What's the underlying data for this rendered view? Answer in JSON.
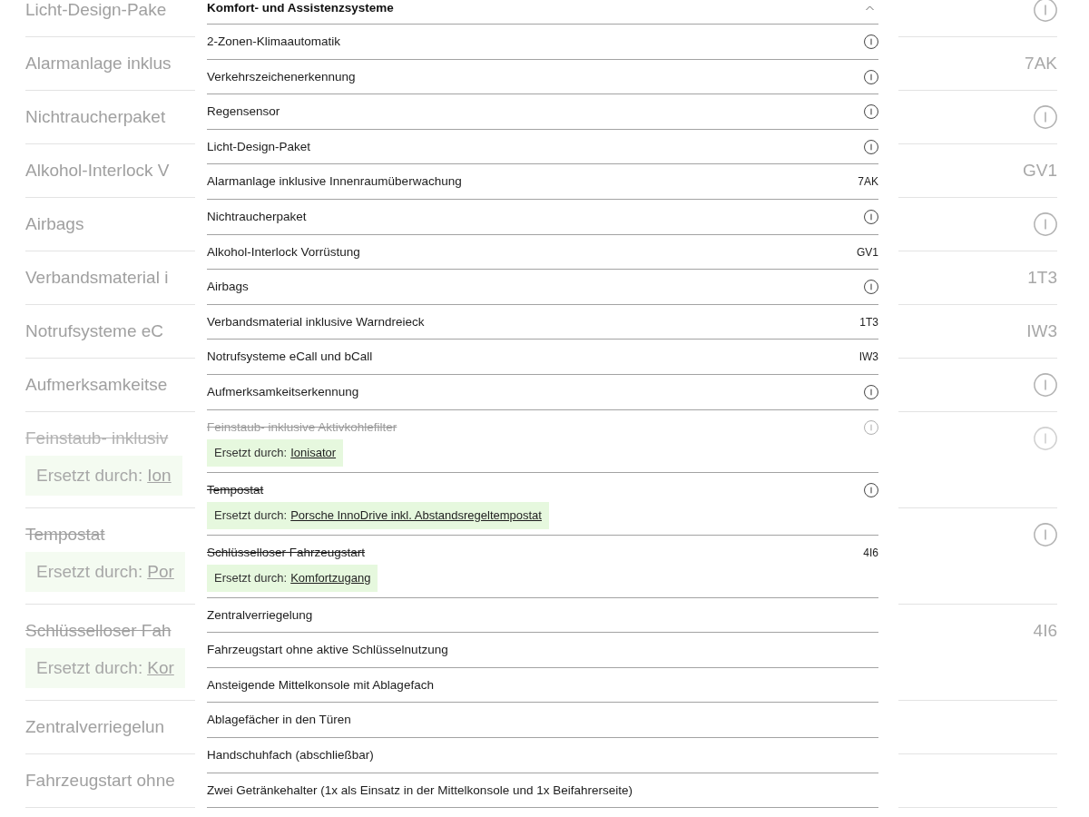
{
  "background_list": {
    "rows": [
      {
        "label": "Licht-Design-Pake",
        "kind": "info",
        "struck": false,
        "dimmed": false
      },
      {
        "label": "Alarmanlage inklus",
        "kind": "code",
        "code": "7AK",
        "struck": false,
        "dimmed": false
      },
      {
        "label": "Nichtraucherpaket",
        "kind": "info",
        "struck": false,
        "dimmed": false
      },
      {
        "label": "Alkohol-Interlock V",
        "kind": "code",
        "code": "GV1",
        "struck": false,
        "dimmed": false
      },
      {
        "label": "Airbags",
        "kind": "info",
        "struck": false,
        "dimmed": false
      },
      {
        "label": "Verbandsmaterial i",
        "kind": "code",
        "code": "1T3",
        "struck": false,
        "dimmed": false
      },
      {
        "label": "Notrufsysteme eC",
        "kind": "code",
        "code": "IW3",
        "struck": false,
        "dimmed": false
      },
      {
        "label": "Aufmerksamkeitse",
        "kind": "info",
        "struck": false,
        "dimmed": false
      },
      {
        "label": "Feinstaub- inklusiv",
        "kind": "info",
        "struck": true,
        "dimmed": true,
        "replacement": {
          "prefix": "Ersetzt durch:",
          "link": "Ion"
        }
      },
      {
        "label": "Tempostat",
        "kind": "info",
        "struck": true,
        "dimmed": false,
        "replacement": {
          "prefix": "Ersetzt durch:",
          "link": "Por"
        }
      },
      {
        "label": "Schlüsselloser Fah",
        "kind": "code",
        "code": "4I6",
        "struck": true,
        "dimmed": false,
        "replacement": {
          "prefix": "Ersetzt durch:",
          "link": "Kor"
        }
      },
      {
        "label": "Zentralverriegelun",
        "kind": "plain",
        "struck": false,
        "dimmed": false
      },
      {
        "label": "Fahrzeugstart ohne",
        "kind": "plain",
        "struck": false,
        "dimmed": false
      }
    ]
  },
  "panel": {
    "title": "Komfort- und Assistenzsysteme",
    "expanded": true,
    "rows": [
      {
        "label": "2-Zonen-Klimaautomatik",
        "kind": "info",
        "struck": false,
        "dimmed": false
      },
      {
        "label": "Verkehrszeichenerkennung",
        "kind": "info",
        "struck": false,
        "dimmed": false
      },
      {
        "label": "Regensensor",
        "kind": "info",
        "struck": false,
        "dimmed": false
      },
      {
        "label": "Licht-Design-Paket",
        "kind": "info",
        "struck": false,
        "dimmed": false
      },
      {
        "label": "Alarmanlage inklusive Innenraumüberwachung",
        "kind": "code",
        "code": "7AK",
        "struck": false,
        "dimmed": false
      },
      {
        "label": "Nichtraucherpaket",
        "kind": "info",
        "struck": false,
        "dimmed": false
      },
      {
        "label": "Alkohol-Interlock Vorrüstung",
        "kind": "code",
        "code": "GV1",
        "struck": false,
        "dimmed": false
      },
      {
        "label": "Airbags",
        "kind": "info",
        "struck": false,
        "dimmed": false
      },
      {
        "label": "Verbandsmaterial inklusive Warndreieck",
        "kind": "code",
        "code": "1T3",
        "struck": false,
        "dimmed": false
      },
      {
        "label": "Notrufsysteme eCall und bCall",
        "kind": "code",
        "code": "IW3",
        "struck": false,
        "dimmed": false
      },
      {
        "label": "Aufmerksamkeitserkennung",
        "kind": "info",
        "struck": false,
        "dimmed": false
      },
      {
        "label": "Feinstaub- inklusive Aktivkohlefilter",
        "kind": "info",
        "struck": true,
        "dimmed": true,
        "replacement": {
          "prefix": "Ersetzt durch:",
          "link": "Ionisator"
        }
      },
      {
        "label": "Tempostat",
        "kind": "info",
        "struck": true,
        "dimmed": false,
        "replacement": {
          "prefix": "Ersetzt durch:",
          "link": "Porsche InnoDrive inkl. Abstandsregeltempostat"
        }
      },
      {
        "label": "Schlüsselloser Fahrzeugstart",
        "kind": "code",
        "code": "4I6",
        "struck": true,
        "dimmed": false,
        "replacement": {
          "prefix": "Ersetzt durch:",
          "link": "Komfortzugang"
        }
      },
      {
        "label": "Zentralverriegelung",
        "kind": "plain",
        "struck": false,
        "dimmed": false
      },
      {
        "label": "Fahrzeugstart ohne aktive Schlüsselnutzung",
        "kind": "plain",
        "struck": false,
        "dimmed": false
      },
      {
        "label": "Ansteigende Mittelkonsole mit Ablagefach",
        "kind": "plain",
        "struck": false,
        "dimmed": false
      },
      {
        "label": "Ablagefächer in den Türen",
        "kind": "plain",
        "struck": false,
        "dimmed": false
      },
      {
        "label": "Handschuhfach (abschließbar)",
        "kind": "plain",
        "struck": false,
        "dimmed": false
      },
      {
        "label": "Zwei Getränkehalter (1x als Einsatz in der Mittelkonsole und 1x Beifahrerseite)",
        "kind": "plain",
        "struck": false,
        "dimmed": false
      }
    ]
  }
}
